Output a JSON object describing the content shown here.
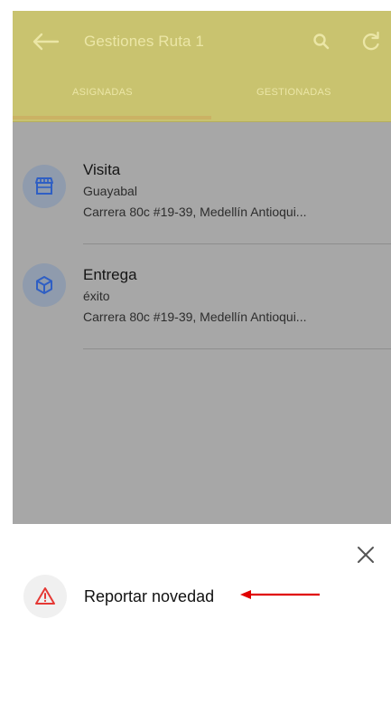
{
  "appbar": {
    "title": "Gestiones Ruta 1",
    "tabs": [
      {
        "label": "ASIGNADAS"
      },
      {
        "label": "GESTIONADAS"
      }
    ]
  },
  "items": [
    {
      "title": "Visita",
      "subtitle": "Guayabal",
      "address": "Carrera 80c #19-39, Medellín Antioqui...",
      "icon": "store-icon"
    },
    {
      "title": "Entrega",
      "subtitle": "éxito",
      "address": "Carrera 80c #19-39, Medellín Antioqui...",
      "icon": "package-icon"
    }
  ],
  "sheet": {
    "action_label": "Reportar novedad",
    "action_icon": "warning-icon"
  },
  "colors": {
    "appbar": "#c9c36f",
    "overlay": "#a7a7a7",
    "icon_blue": "#2f5fc4",
    "warning_red": "#e53935",
    "annotation_arrow": "#e00000"
  }
}
